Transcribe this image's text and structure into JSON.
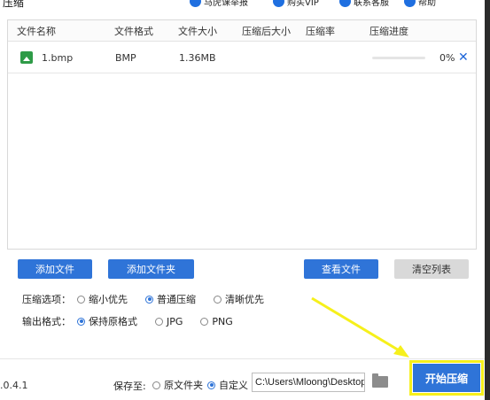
{
  "window": {
    "title": "压缩",
    "nav": [
      {
        "label": "马虎课举报"
      },
      {
        "label": "购买VIP"
      },
      {
        "label": "联系客服"
      },
      {
        "label": "帮助"
      }
    ]
  },
  "table": {
    "headers": [
      "文件名称",
      "文件格式",
      "文件大小",
      "压缩后大小",
      "压缩率",
      "压缩进度"
    ],
    "rows": [
      {
        "name": "1.bmp",
        "format": "BMP",
        "size": "1.36MB",
        "compressed_size": "",
        "ratio": "",
        "progress_text": "0%",
        "progress_value": 0
      }
    ]
  },
  "buttons": {
    "add_file": "添加文件",
    "add_folder": "添加文件夹",
    "view_file": "查看文件",
    "clear_list": "清空列表"
  },
  "compress_options": {
    "label": "压缩选项：",
    "options": [
      "缩小优先",
      "普通压缩",
      "清晰优先"
    ],
    "selected": "普通压缩"
  },
  "output_format": {
    "label": "输出格式：",
    "options": [
      "保持原格式",
      "JPG",
      "PNG"
    ],
    "selected": "保持原格式"
  },
  "footer": {
    "version": ".0.4.1",
    "save_label": "保存至:",
    "save_options": [
      "原文件夹",
      "自定义"
    ],
    "save_selected": "自定义",
    "path": "C:\\Users\\Mloong\\Desktop",
    "start_button": "开始压缩"
  },
  "colors": {
    "accent": "#2f74d8",
    "highlight": "#f6f01b"
  }
}
